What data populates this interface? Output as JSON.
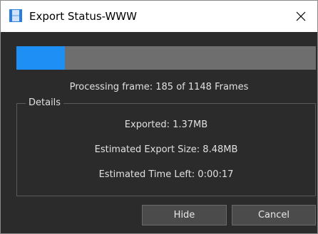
{
  "window": {
    "title": "Export Status-WWW"
  },
  "icons": {
    "app": "film-strip-icon",
    "close": "close-icon"
  },
  "progress": {
    "fraction": 0.161,
    "text": "Processing frame: 185 of 1148 Frames"
  },
  "details": {
    "legend": "Details",
    "exported": "Exported: 1.37MB",
    "estimated_size": "Estimated Export Size: 8.48MB",
    "time_left": "Estimated Time Left: 0:00:17"
  },
  "buttons": {
    "hide": "Hide",
    "cancel": "Cancel"
  },
  "colors": {
    "accent": "#1e8ff5",
    "background": "#2b2b2b",
    "track": "#6e6e6e"
  }
}
